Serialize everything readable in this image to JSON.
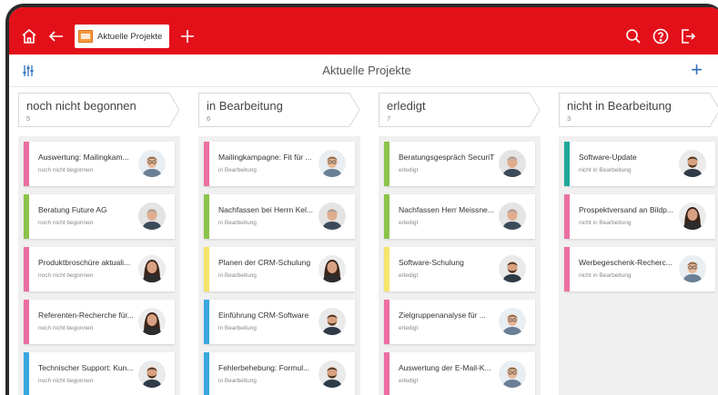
{
  "titlebar": {
    "tab_label": "Aktuelle Projekte",
    "icons": [
      "home-icon",
      "back-arrow-icon",
      "add-tab-icon",
      "search-icon",
      "help-icon",
      "logout-icon"
    ]
  },
  "header": {
    "title": "Aktuelle Projekte",
    "filter_icon": "filter-sliders-icon",
    "add_icon": "plus-icon"
  },
  "colors": {
    "brand_red": "#e3101a",
    "accent_blue": "#2e6fb8",
    "pink": "#ec6fa2",
    "green": "#8bc34a",
    "yellow": "#f6e46a",
    "blue": "#3aa8e0",
    "teal": "#1fa89a"
  },
  "columns": [
    {
      "title": "noch nicht begonnen",
      "count": "5",
      "cards": [
        {
          "text": "Auswertung: Mailingkam...",
          "status": "noch nicht begonnen",
          "color": "#ec6fa2",
          "avatar": "man-glasses"
        },
        {
          "text": "Beratung Future AG",
          "status": "noch nicht begonnen",
          "color": "#8bc34a",
          "avatar": "man-grey"
        },
        {
          "text": "Produktbroschüre aktuali...",
          "status": "noch nicht begonnen",
          "color": "#ec6fa2",
          "avatar": "woman-dark"
        },
        {
          "text": "Referenten-Recherche für...",
          "status": "noch nicht begonnen",
          "color": "#ec6fa2",
          "avatar": "woman-dark"
        },
        {
          "text": "Technischer Support: Kun...",
          "status": "noch nicht begonnen",
          "color": "#3aa8e0",
          "avatar": "man-beard"
        }
      ]
    },
    {
      "title": "in Bearbeitung",
      "count": "6",
      "cards": [
        {
          "text": "Mailingkampagne: Fit für ...",
          "status": "in Bearbeitung",
          "color": "#ec6fa2",
          "avatar": "man-glasses"
        },
        {
          "text": "Nachfassen bei Herrn Kel...",
          "status": "in Bearbeitung",
          "color": "#8bc34a",
          "avatar": "man-grey"
        },
        {
          "text": "Planen der CRM-Schulung",
          "status": "in Bearbeitung",
          "color": "#f6e46a",
          "avatar": "woman-dark"
        },
        {
          "text": "Einführung CRM-Software",
          "status": "in Bearbeitung",
          "color": "#3aa8e0",
          "avatar": "man-beard"
        },
        {
          "text": "Fehlerbehebung: Formul...",
          "status": "in Bearbeitung",
          "color": "#3aa8e0",
          "avatar": "man-beard"
        }
      ]
    },
    {
      "title": "erledigt",
      "count": "7",
      "cards": [
        {
          "text": "Beratungsgespräch SecuriT",
          "status": "erledigt",
          "color": "#8bc34a",
          "avatar": "man-grey"
        },
        {
          "text": "Nachfassen Herr Meissne...",
          "status": "erledigt",
          "color": "#8bc34a",
          "avatar": "man-grey"
        },
        {
          "text": "Software-Schulung",
          "status": "erledigt",
          "color": "#f6e46a",
          "avatar": "man-beard"
        },
        {
          "text": "Zielgruppenanalyse für ...",
          "status": "erledigt",
          "color": "#ec6fa2",
          "avatar": "man-glasses"
        },
        {
          "text": "Auswertung der E-Mail-K...",
          "status": "erledigt",
          "color": "#ec6fa2",
          "avatar": "man-glasses"
        }
      ]
    },
    {
      "title": "nicht in Bearbeitung",
      "count": "3",
      "cards": [
        {
          "text": "Software-Update",
          "status": "nicht in Bearbeitung",
          "color": "#1fa89a",
          "avatar": "man-beard"
        },
        {
          "text": "Prospektversand an Bildp...",
          "status": "nicht in Bearbeitung",
          "color": "#ec6fa2",
          "avatar": "woman-dark"
        },
        {
          "text": "Werbegeschenk-Recherc...",
          "status": "nicht in Bearbeitung",
          "color": "#ec6fa2",
          "avatar": "man-glasses"
        }
      ]
    }
  ]
}
